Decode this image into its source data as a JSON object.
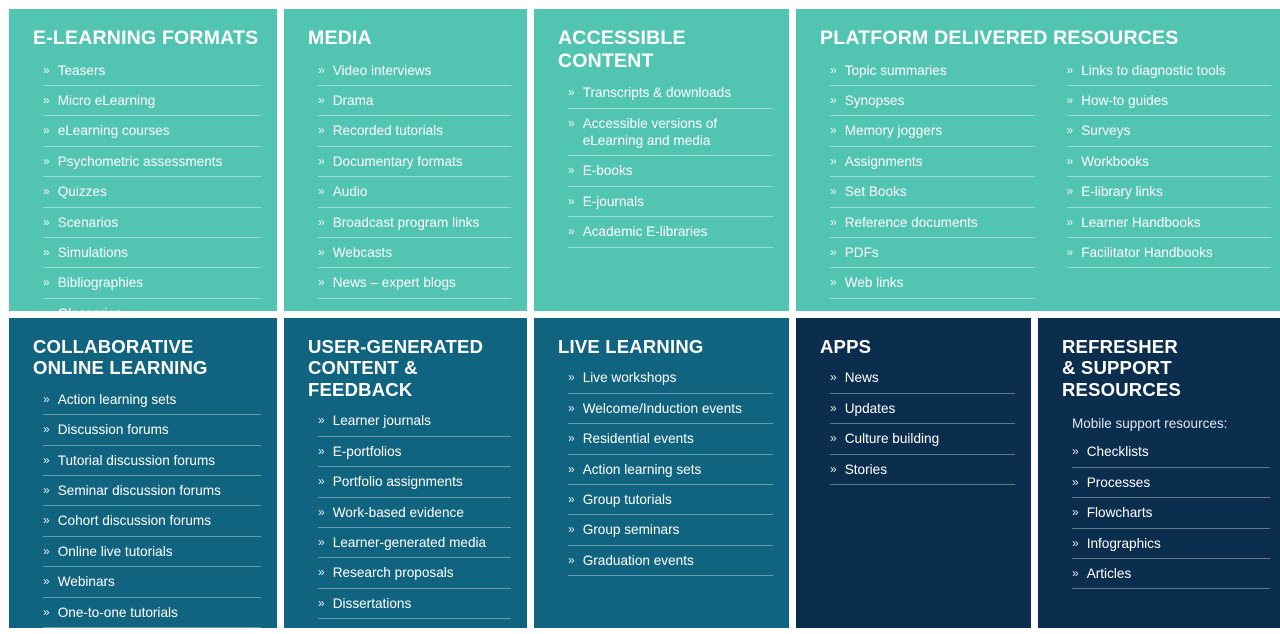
{
  "colors": {
    "teal": "#52c5b2",
    "blue": "#106480",
    "navy": "#0c2e4e",
    "text": "#ffffff",
    "page_background": "#ffffff"
  },
  "icons": {
    "bullet": "» ",
    "bullet_name": "double-chevron-right-icon"
  },
  "panels": [
    {
      "id": "e-learning-formats",
      "title": "E-LEARNING FORMATS",
      "theme": "teal",
      "columns": [
        {
          "items": [
            "Teasers",
            "Micro eLearning",
            "eLearning courses",
            "Psychometric assessments",
            "Quizzes",
            "Scenarios",
            "Simulations",
            "Bibliographies",
            "Glossaries"
          ]
        }
      ]
    },
    {
      "id": "media",
      "title": "MEDIA",
      "theme": "teal",
      "columns": [
        {
          "items": [
            "Video interviews",
            "Drama",
            "Recorded tutorials",
            "Documentary formats",
            "Audio",
            "Broadcast program links",
            "Webcasts",
            "News – expert blogs"
          ]
        }
      ]
    },
    {
      "id": "accessible-content",
      "title": "ACCESSIBLE CONTENT",
      "theme": "teal",
      "columns": [
        {
          "items": [
            "Transcripts & downloads",
            "Accessible versions of eLearning and media",
            "E-books",
            "E-journals",
            "Academic E-libraries"
          ]
        }
      ]
    },
    {
      "id": "platform-delivered-resources",
      "title": "PLATFORM DELIVERED RESOURCES",
      "theme": "teal",
      "columns": [
        {
          "items": [
            "Topic summaries",
            "Synopses",
            "Memory joggers",
            "Assignments",
            "Set Books",
            "Reference documents",
            "PDFs",
            "Web links"
          ]
        },
        {
          "items": [
            "Links to diagnostic tools",
            "How-to guides",
            "Surveys",
            "Workbooks",
            "E-library links",
            "Learner Handbooks",
            "Facilitator Handbooks"
          ]
        }
      ]
    },
    {
      "id": "collaborative-online-learning",
      "title": "COLLABORATIVE\nONLINE LEARNING",
      "theme": "blue",
      "columns": [
        {
          "items": [
            "Action learning sets",
            "Discussion forums",
            "Tutorial discussion forums",
            "Seminar discussion forums",
            "Cohort discussion forums",
            "Online live tutorials",
            "Webinars",
            "One-to-one tutorials"
          ]
        }
      ]
    },
    {
      "id": "user-generated-content-and-feedback",
      "title": "USER-GENERATED\nCONTENT & FEEDBACK",
      "theme": "blue",
      "columns": [
        {
          "items": [
            "Learner journals",
            "E-portfolios",
            "Portfolio assignments",
            "Work-based evidence",
            "Learner-generated media",
            "Research proposals",
            "Dissertations"
          ]
        }
      ]
    },
    {
      "id": "live-learning",
      "title": "LIVE LEARNING",
      "theme": "blue",
      "columns": [
        {
          "items": [
            "Live workshops",
            "Welcome/Induction events",
            "Residential events",
            "Action learning sets",
            "Group tutorials",
            "Group seminars",
            "Graduation events"
          ]
        }
      ]
    },
    {
      "id": "apps",
      "title": "APPS",
      "theme": "navy",
      "columns": [
        {
          "items": [
            "News",
            "Updates",
            "Culture building",
            "Stories"
          ]
        }
      ]
    },
    {
      "id": "refresher-and-support-resources",
      "title": "REFRESHER\n& SUPPORT\nRESOURCES",
      "theme": "navy",
      "subnote": "Mobile support resources:",
      "columns": [
        {
          "items": [
            "Checklists",
            "Processes",
            "Flowcharts",
            "Infographics",
            "Articles"
          ]
        }
      ]
    }
  ],
  "layout": {
    "rows": [
      {
        "panel_ids": [
          "e-learning-formats",
          "media",
          "accessible-content",
          "platform-delivered-resources"
        ],
        "flex": [
          268,
          243,
          255,
          491
        ]
      },
      {
        "panel_ids": [
          "collaborative-online-learning",
          "user-generated-content-and-feedback",
          "live-learning",
          "apps",
          "refresher-and-support-resources"
        ],
        "flex": [
          268,
          243,
          255,
          235,
          248
        ]
      }
    ]
  }
}
